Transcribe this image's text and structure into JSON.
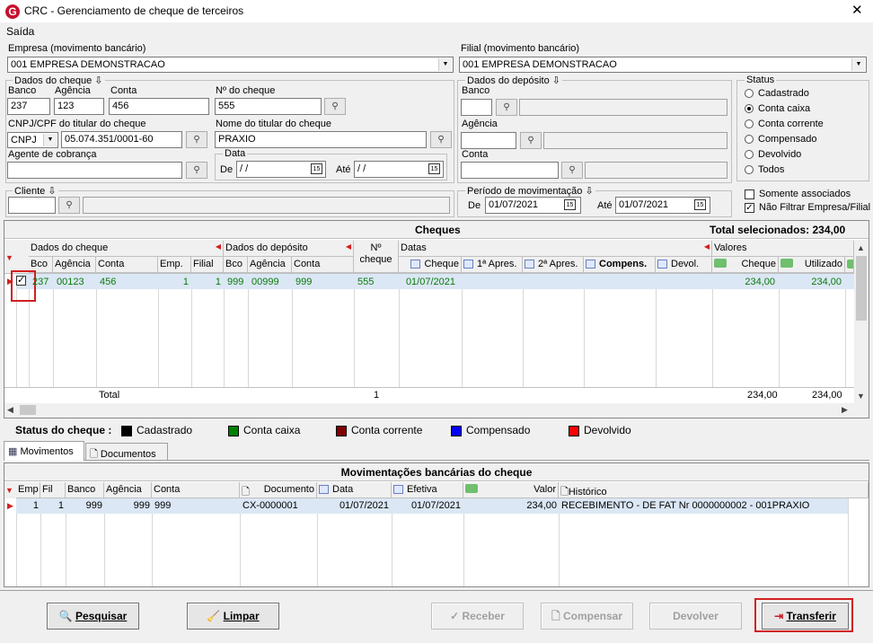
{
  "window": {
    "title": "CRC - Gerenciamento de cheque de terceiros",
    "close": "✕",
    "logo": "G"
  },
  "menu": {
    "saida": "Saída"
  },
  "empresa": {
    "label": "Empresa (movimento bancário)",
    "value": "001 EMPRESA DEMONSTRACAO"
  },
  "filial": {
    "label": "Filial (movimento bancário)",
    "value": "001 EMPRESA DEMONSTRACAO"
  },
  "dados_cheque": {
    "title": "Dados do cheque",
    "banco_label": "Banco",
    "banco": "237",
    "agencia_label": "Agência",
    "agencia": "123",
    "conta_label": "Conta",
    "conta": "456",
    "num_label": "Nº do cheque",
    "num": "555",
    "cnpj_label": "CNPJ/CPF do titular do cheque",
    "cnpj_type": "CNPJ",
    "cnpj": "05.074.351/0001-60",
    "nome_label": "Nome do titular do cheque",
    "nome": "PRAXIO",
    "agente_label": "Agente de cobrança",
    "agente": "",
    "data_title": "Data",
    "de_label": "De",
    "de": " / /",
    "ate_label": "Até",
    "ate": " / /"
  },
  "dados_deposito": {
    "title": "Dados do depósito",
    "banco_label": "Banco",
    "banco": "",
    "agencia_label": "Agência",
    "agencia": "",
    "conta_label": "Conta",
    "conta": ""
  },
  "status": {
    "title": "Status",
    "options": [
      "Cadastrado",
      "Conta caixa",
      "Conta corrente",
      "Compensado",
      "Devolvido",
      "Todos"
    ],
    "selected": 1
  },
  "cliente": {
    "title": "Cliente",
    "value": ""
  },
  "periodo": {
    "title": "Período de movimentação",
    "de_label": "De",
    "de": "01/07/2021",
    "ate_label": "Até",
    "ate": "01/07/2021"
  },
  "checks": {
    "somente": "Somente associados",
    "nao_filtrar": "Não Filtrar Empresa/Filial"
  },
  "cheques_grid": {
    "title": "Cheques",
    "total_sel_label": "Total selecionados:",
    "total_sel": "234,00",
    "groups": {
      "dados_cheque": "Dados do cheque",
      "dados_deposito": "Dados do depósito",
      "num1": "Nº",
      "num2": "cheque",
      "datas": "Datas",
      "valores": "Valores"
    },
    "cols": {
      "bco": "Bco",
      "agencia": "Agência",
      "conta": "Conta",
      "emp": "Emp.",
      "filial": "Filial",
      "dbco": "Bco",
      "dagencia": "Agência",
      "dconta": "Conta",
      "cheque": "Cheque",
      "apres1": "1ª Apres.",
      "apres2": "2ª Apres.",
      "compens": "Compens.",
      "devol": "Devol.",
      "vcheque": "Cheque",
      "utilizado": "Utilizado"
    },
    "row": {
      "bco": "237",
      "agencia": "00123",
      "conta": "456",
      "emp": "1",
      "filial": "1",
      "dbco": "999",
      "dagencia": "00999",
      "dconta": "999",
      "num": "555",
      "data": "01/07/2021",
      "vcheque": "234,00",
      "utilizado": "234,00"
    },
    "footer": {
      "total": "Total",
      "count": "1",
      "vcheque": "234,00",
      "utilizado": "234,00"
    }
  },
  "legend": {
    "title": "Status do cheque :",
    "items": [
      {
        "label": "Cadastrado",
        "color": "#000000"
      },
      {
        "label": "Conta caixa",
        "color": "#008000"
      },
      {
        "label": "Conta corrente",
        "color": "#800000"
      },
      {
        "label": "Compensado",
        "color": "#0000ff"
      },
      {
        "label": "Devolvido",
        "color": "#ff0000"
      }
    ]
  },
  "tabs": {
    "movimentos": "Movimentos",
    "documentos": "Documentos"
  },
  "mov_grid": {
    "title": "Movimentações bancárias do cheque",
    "cols": {
      "emp": "Emp",
      "fil": "Fil",
      "banco": "Banco",
      "agencia": "Agência",
      "conta": "Conta",
      "documento": "Documento",
      "data": "Data",
      "efetiva": "Efetiva",
      "valor": "Valor",
      "historico": "Histórico"
    },
    "row": {
      "emp": "1",
      "fil": "1",
      "banco": "999",
      "agencia": "999",
      "conta": "999",
      "documento": "CX-0000001",
      "data": "01/07/2021",
      "efetiva": "01/07/2021",
      "valor": "234,00",
      "historico": "RECEBIMENTO - DE FAT Nr 0000000002 - 001PRAXIO"
    }
  },
  "buttons": {
    "pesquisar": "Pesquisar",
    "limpar": "Limpar",
    "receber": "Receber",
    "compensar": "Compensar",
    "devolver": "Devolver",
    "transferir": "Transferir"
  }
}
